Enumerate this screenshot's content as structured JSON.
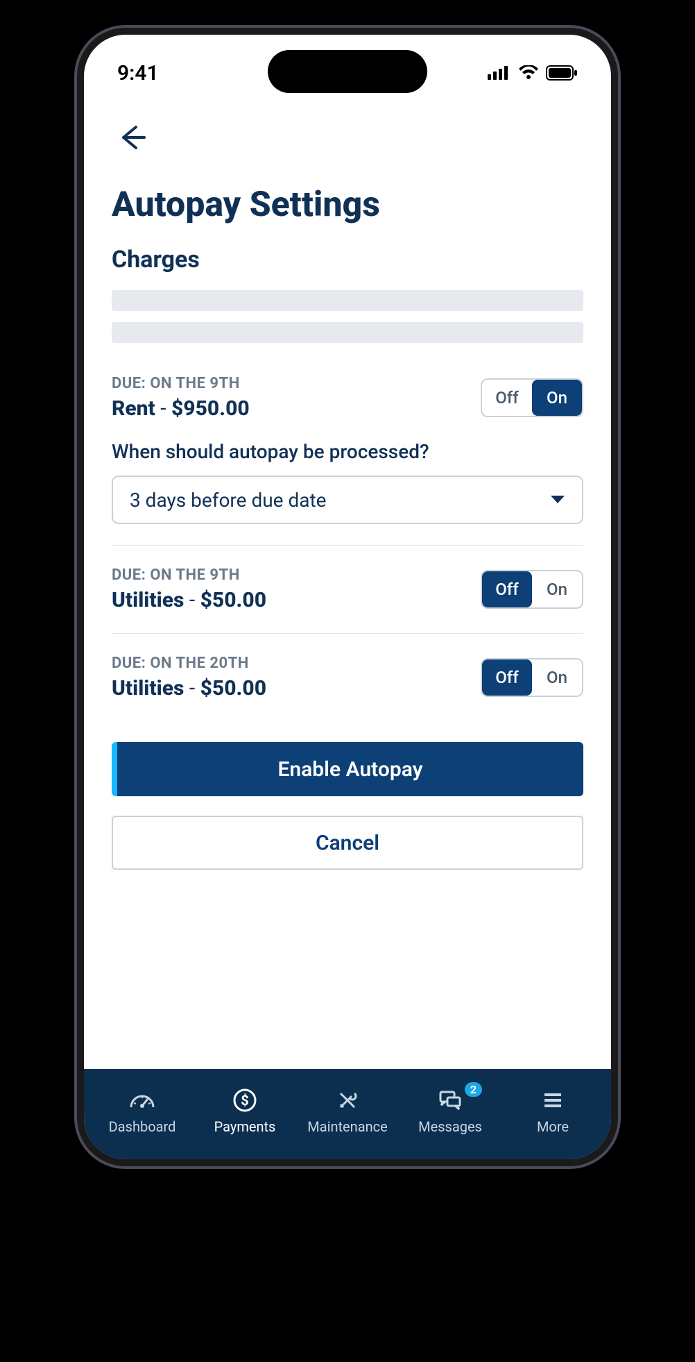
{
  "status": {
    "time": "9:41"
  },
  "page": {
    "title": "Autopay Settings",
    "section": "Charges",
    "question": "When should autopay be processed?",
    "select_value": "3 days before due date",
    "primary_btn": "Enable Autopay",
    "secondary_btn": "Cancel"
  },
  "toggle": {
    "off": "Off",
    "on": "On"
  },
  "charges": [
    {
      "due_label": "DUE:",
      "due_value": "ON THE 9TH",
      "name": "Rent",
      "sep": " - ",
      "amount": "$950.00",
      "state": "on",
      "expanded": true
    },
    {
      "due_label": "DUE:",
      "due_value": "ON THE 9TH",
      "name": "Utilities",
      "sep": " - ",
      "amount": "$50.00",
      "state": "off",
      "expanded": false
    },
    {
      "due_label": "DUE:",
      "due_value": "ON THE 20TH",
      "name": "Utilities",
      "sep": " - ",
      "amount": "$50.00",
      "state": "off",
      "expanded": false
    }
  ],
  "tabs": {
    "dashboard": "Dashboard",
    "payments": "Payments",
    "maintenance": "Maintenance",
    "messages": "Messages",
    "more": "More",
    "badge": "2"
  }
}
